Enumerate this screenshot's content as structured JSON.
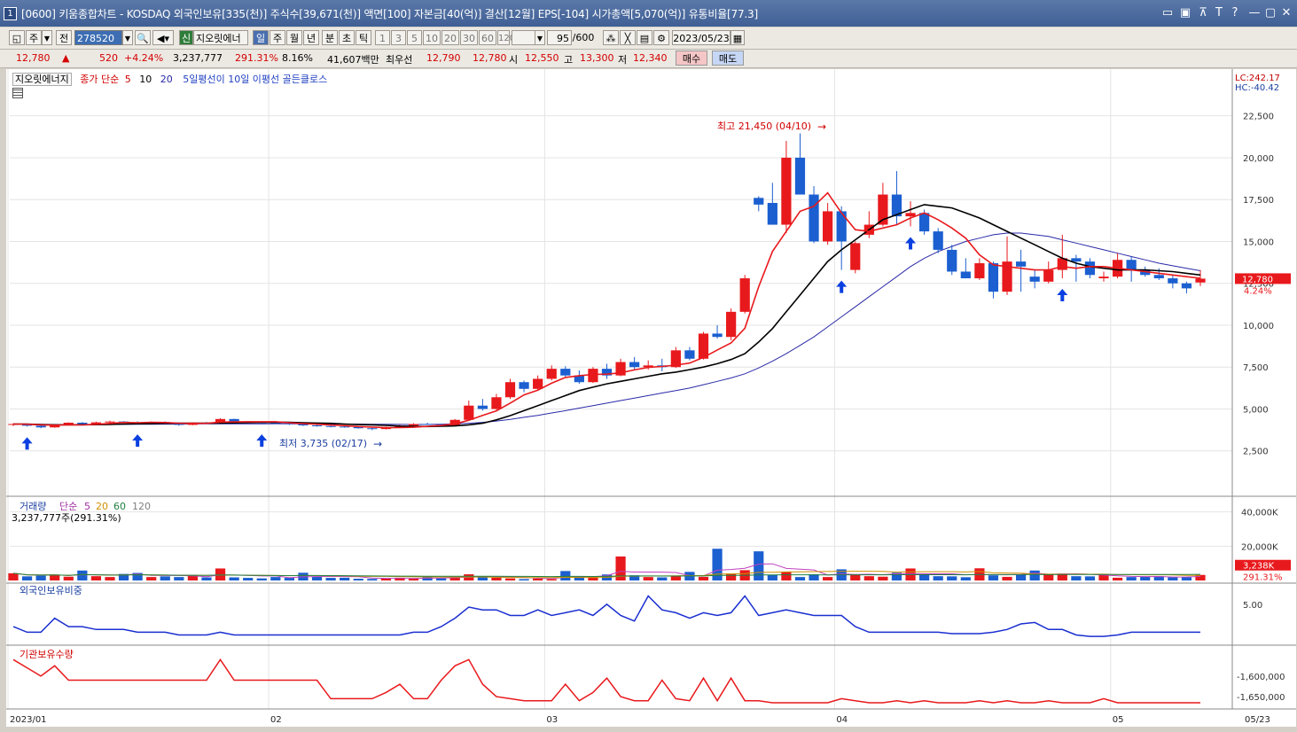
{
  "title": {
    "win_number": "1",
    "text": "[0600] 키움종합차트 - KOSDAQ 외국인보유[335(천)] 주식수[39,671(천)] 액면[100] 자본금[40(억)] 결산[12월] EPS[-104] 시가총액[5,070(억)] 유통비율[77.3]",
    "controls": [
      "▭",
      "▣",
      "⊼",
      "T",
      "?",
      "—",
      "▢",
      "✕"
    ]
  },
  "toolbar": {
    "period_label": "주",
    "prev_label": "전",
    "code": "278520",
    "name_tag": "신",
    "stock_name": "지오릿에너",
    "periods": [
      "일",
      "주",
      "월",
      "년",
      "분",
      "초",
      "틱"
    ],
    "active_period": "일",
    "intervals": [
      "1",
      "3",
      "5",
      "10",
      "20",
      "30",
      "60",
      "120"
    ],
    "count_value": "95",
    "count_total": "/600",
    "date": "2023/05/23"
  },
  "quote": {
    "price": "12,780",
    "arrow": "▲",
    "change": "520",
    "change_pct": "+4.24%",
    "volume": "3,237,777",
    "vol_ratio": "291.31%",
    "turnover": "8.16%",
    "amount": "41,607백만",
    "pref_label": "최우선",
    "ask": "12,790",
    "bid": "12,780",
    "open_label": "시",
    "open": "12,550",
    "high_label": "고",
    "high": "13,300",
    "low_label": "저",
    "low": "12,340",
    "buy_label": "매수",
    "sell_label": "매도"
  },
  "legend": {
    "stock_name": "지오릿에너지",
    "ma_label": "종가 단순",
    "ma_periods": [
      "5",
      "10",
      "20"
    ],
    "signal": "5일평선이 10일 이평선 골든클로스"
  },
  "price_panel": {
    "lc": "LC:242.17",
    "hc": "HC:-40.42",
    "yticks": [
      "22,500",
      "20,000",
      "17,500",
      "15,000",
      "12,500",
      "10,000",
      "7,500",
      "5,000",
      "2,500"
    ],
    "last_price": "12,780",
    "last_pct": "4.24%",
    "high_annotation": "최고 21,450 (04/10)",
    "low_annotation": "최저 3,735 (02/17)"
  },
  "volume_panel": {
    "label": "거래량",
    "ma_label": "단순",
    "ma_periods": [
      "5",
      "20",
      "60",
      "120"
    ],
    "current": "3,237,777주(291.31%)",
    "yticks": [
      "40,000K",
      "20,000K"
    ],
    "last_vol": "3,238K",
    "last_ratio": "291.31%"
  },
  "foreign_panel": {
    "label": "외국인보유비중",
    "ytick": "5.00"
  },
  "inst_panel": {
    "label": "기관보유수량",
    "yticks": [
      "-1,600,000",
      "-1,650,000"
    ]
  },
  "xaxis": {
    "labels": [
      "2023/01",
      "02",
      "03",
      "04",
      "05"
    ],
    "end_label": "05/23"
  },
  "colors": {
    "up": "#e8191c",
    "down": "#1b5fd0",
    "ma5": "#e8191c",
    "ma10": "#000000",
    "ma20": "#2a2aa8",
    "signal": "#0a3fe0"
  },
  "chart_data": {
    "type": "candlestick",
    "title": "지오릿에너지",
    "x": [
      "2023-01",
      "2023-02",
      "2023-03",
      "2023-04",
      "2023-05"
    ],
    "candles": [
      [
        4050,
        4150,
        3980,
        4100
      ],
      [
        4100,
        4120,
        3950,
        4000
      ],
      [
        4000,
        4020,
        3850,
        3900
      ],
      [
        3900,
        4080,
        3880,
        4050
      ],
      [
        4050,
        4200,
        4000,
        4180
      ],
      [
        4180,
        4220,
        4050,
        4100
      ],
      [
        4100,
        4250,
        4080,
        4200
      ],
      [
        4200,
        4300,
        4150,
        4250
      ],
      [
        4250,
        4270,
        4150,
        4200
      ],
      [
        4200,
        4260,
        4120,
        4150
      ],
      [
        4150,
        4250,
        4100,
        4220
      ],
      [
        4220,
        4260,
        4080,
        4120
      ],
      [
        4120,
        4150,
        4000,
        4050
      ],
      [
        4050,
        4200,
        4030,
        4180
      ],
      [
        4180,
        4220,
        4100,
        4150
      ],
      [
        4150,
        4450,
        4120,
        4400
      ],
      [
        4400,
        4420,
        4200,
        4250
      ],
      [
        4250,
        4280,
        4150,
        4200
      ],
      [
        4200,
        4230,
        4120,
        4180
      ],
      [
        4180,
        4210,
        4100,
        4150
      ],
      [
        4150,
        4180,
        4050,
        4100
      ],
      [
        4100,
        4120,
        3980,
        4020
      ],
      [
        4020,
        4050,
        3940,
        3980
      ],
      [
        3980,
        4010,
        3900,
        3950
      ],
      [
        3950,
        4000,
        3880,
        3920
      ],
      [
        3920,
        3960,
        3820,
        3850
      ],
      [
        3850,
        3900,
        3735,
        3800
      ],
      [
        3800,
        3950,
        3780,
        3900
      ],
      [
        3900,
        4050,
        3880,
        4000
      ],
      [
        4000,
        4150,
        3980,
        4100
      ],
      [
        4100,
        4180,
        4050,
        4080
      ],
      [
        4080,
        4120,
        3980,
        4000
      ],
      [
        4000,
        4400,
        3990,
        4350
      ],
      [
        4350,
        5500,
        4300,
        5200
      ],
      [
        5200,
        5600,
        4900,
        5000
      ],
      [
        5000,
        5900,
        4950,
        5700
      ],
      [
        5700,
        6800,
        5600,
        6600
      ],
      [
        6600,
        6700,
        6000,
        6200
      ],
      [
        6200,
        7000,
        6100,
        6800
      ],
      [
        6800,
        7600,
        6700,
        7400
      ],
      [
        7400,
        7550,
        6900,
        7000
      ],
      [
        7000,
        7300,
        6500,
        6600
      ],
      [
        6600,
        7500,
        6550,
        7400
      ],
      [
        7400,
        7700,
        6800,
        7000
      ],
      [
        7000,
        8000,
        6950,
        7800
      ],
      [
        7800,
        8100,
        7300,
        7500
      ],
      [
        7500,
        7900,
        7350,
        7600
      ],
      [
        7600,
        8000,
        7250,
        7500
      ],
      [
        7500,
        8700,
        7450,
        8500
      ],
      [
        8500,
        8700,
        7900,
        8000
      ],
      [
        8000,
        9600,
        7950,
        9500
      ],
      [
        9500,
        10000,
        9200,
        9300
      ],
      [
        9300,
        11000,
        9100,
        10800
      ],
      [
        10800,
        13000,
        10700,
        12800
      ],
      [
        17600,
        17700,
        16800,
        17200
      ],
      [
        17300,
        18500,
        16000,
        16000
      ],
      [
        16000,
        21000,
        15500,
        20000
      ],
      [
        20000,
        21450,
        19500,
        17800
      ],
      [
        17800,
        18300,
        14900,
        15000
      ],
      [
        15000,
        17300,
        14800,
        16800
      ],
      [
        16800,
        17100,
        13300,
        15000
      ],
      [
        13300,
        15000,
        13100,
        14900
      ],
      [
        15400,
        16800,
        15200,
        16000
      ],
      [
        16000,
        18500,
        15900,
        17800
      ],
      [
        17800,
        19200,
        16000,
        16500
      ],
      [
        16500,
        17400,
        15900,
        16700
      ],
      [
        16700,
        16900,
        15400,
        15600
      ],
      [
        15600,
        15800,
        14300,
        14500
      ],
      [
        14500,
        14800,
        13000,
        13200
      ],
      [
        13200,
        14000,
        12800,
        12800
      ],
      [
        12800,
        14000,
        12700,
        13700
      ],
      [
        13700,
        13800,
        11600,
        12000
      ],
      [
        12000,
        15300,
        11800,
        13800
      ],
      [
        13800,
        14500,
        12000,
        13500
      ],
      [
        12900,
        13300,
        12200,
        12600
      ],
      [
        12600,
        13800,
        12500,
        13300
      ],
      [
        13300,
        15400,
        12800,
        14000
      ],
      [
        14000,
        14200,
        12600,
        13800
      ],
      [
        13800,
        14000,
        12800,
        13000
      ],
      [
        12800,
        13200,
        12600,
        12900
      ],
      [
        12900,
        14300,
        12800,
        13900
      ],
      [
        13900,
        14100,
        12600,
        13300
      ],
      [
        13300,
        13500,
        12900,
        13000
      ],
      [
        13000,
        13400,
        12700,
        12800
      ],
      [
        12800,
        13000,
        12200,
        12500
      ],
      [
        12500,
        12600,
        11900,
        12200
      ],
      [
        12550,
        13300,
        12340,
        12780
      ]
    ],
    "ma5": [
      4100,
      4090,
      4050,
      4030,
      4056,
      4046,
      4082,
      4136,
      4196,
      4180,
      4205,
      4188,
      4148,
      4144,
      4144,
      4216,
      4228,
      4236,
      4238,
      4236,
      4176,
      4126,
      4090,
      4044,
      4004,
      3954,
      3922,
      3882,
      3888,
      3912,
      3962,
      4016,
      4106,
      4330,
      4618,
      4890,
      5350,
      5840,
      6120,
      6540,
      6880,
      6990,
      7060,
      7080,
      7160,
      7330,
      7480,
      7540,
      7620,
      7740,
      8080,
      8520,
      8940,
      9820,
      12300,
      14400,
      15600,
      16800,
      17100,
      17900,
      16700,
      15700,
      15600,
      15800,
      16000,
      16400,
      16700,
      16300,
      15800,
      15200,
      14200,
      13600,
      13500,
      13400,
      13300,
      13300,
      13500,
      13400,
      13500,
      13500,
      13400,
      13300,
      13200,
      13100,
      13000,
      12900,
      12800
    ],
    "ma10": [
      4100,
      4095,
      4066,
      4050,
      4060,
      4055,
      4065,
      4080,
      4100,
      4115,
      4130,
      4140,
      4148,
      4150,
      4150,
      4160,
      4170,
      4180,
      4200,
      4210,
      4200,
      4180,
      4160,
      4140,
      4100,
      4070,
      4050,
      4020,
      3980,
      3960,
      3950,
      3970,
      3990,
      4050,
      4150,
      4350,
      4600,
      4900,
      5200,
      5500,
      5800,
      6100,
      6300,
      6500,
      6650,
      6800,
      6950,
      7100,
      7200,
      7350,
      7500,
      7700,
      7950,
      8300,
      9000,
      9800,
      10800,
      11800,
      12800,
      13800,
      14500,
      15100,
      15700,
      16300,
      16600,
      16900,
      17200,
      17100,
      17000,
      16700,
      16400,
      16000,
      15600,
      15200,
      14800,
      14400,
      14000,
      13700,
      13500,
      13400,
      13300,
      13300,
      13300,
      13250,
      13200,
      13100,
      13000
    ],
    "ma20": [
      4100,
      4095,
      4080,
      4075,
      4070,
      4070,
      4072,
      4075,
      4080,
      4085,
      4090,
      4095,
      4100,
      4105,
      4108,
      4110,
      4112,
      4115,
      4118,
      4120,
      4118,
      4115,
      4110,
      4105,
      4100,
      4095,
      4090,
      4085,
      4080,
      4075,
      4080,
      4090,
      4110,
      4150,
      4200,
      4280,
      4380,
      4500,
      4620,
      4760,
      4900,
      5050,
      5200,
      5350,
      5500,
      5650,
      5800,
      5950,
      6100,
      6250,
      6450,
      6650,
      6850,
      7100,
      7450,
      7850,
      8300,
      8800,
      9300,
      9900,
      10500,
      11100,
      11700,
      12300,
      12900,
      13500,
      14000,
      14400,
      14700,
      15000,
      15200,
      15400,
      15500,
      15500,
      15400,
      15300,
      15100,
      14900,
      14700,
      14500,
      14300,
      14100,
      13900,
      13700,
      13550,
      13400,
      13250
    ],
    "volume": [
      4200,
      2400,
      2800,
      3400,
      2200,
      5800,
      2500,
      2000,
      3800,
      4400,
      2000,
      2400,
      2000,
      3000,
      1800,
      7000,
      1800,
      1500,
      1200,
      2000,
      1500,
      4500,
      2200,
      1500,
      1600,
      1000,
      900,
      1200,
      1600,
      1300,
      1800,
      1200,
      2000,
      3600,
      1800,
      1600,
      1200,
      800,
      1100,
      800,
      5500,
      2000,
      2000,
      3500,
      14000,
      3000,
      2000,
      1800,
      2500,
      5000,
      2100,
      18500,
      4000,
      6000,
      17000,
      3200,
      5000,
      2000,
      3600,
      2000,
      6500,
      3600,
      2500,
      2200,
      4500,
      7000,
      3100,
      2500,
      2400,
      1900,
      7100,
      3000,
      2100,
      3600,
      5800,
      3500,
      4000,
      2500,
      2400,
      3300,
      1600,
      2000,
      2200,
      2500,
      1800,
      1900,
      3238
    ],
    "foreign_ratio": [
      4.2,
      4.0,
      4.0,
      4.5,
      4.2,
      4.2,
      4.1,
      4.1,
      4.1,
      4.0,
      4.0,
      4.0,
      3.9,
      3.9,
      3.9,
      4.0,
      3.9,
      3.9,
      3.9,
      3.9,
      3.9,
      3.9,
      3.9,
      3.9,
      3.9,
      3.9,
      3.9,
      3.9,
      3.9,
      4.0,
      4.0,
      4.2,
      4.5,
      4.9,
      4.8,
      4.8,
      4.6,
      4.6,
      4.8,
      4.6,
      4.7,
      4.8,
      4.6,
      5.0,
      4.6,
      4.4,
      5.3,
      4.8,
      4.7,
      4.5,
      4.7,
      4.6,
      4.7,
      5.3,
      4.6,
      4.7,
      4.8,
      4.7,
      4.6,
      4.6,
      4.6,
      4.2,
      4.0,
      4.0,
      4.0,
      4.0,
      4.0,
      4.0,
      3.95,
      3.95,
      3.95,
      4.0,
      4.1,
      4.3,
      4.35,
      4.1,
      4.1,
      3.9,
      3.85,
      3.85,
      3.9,
      4.0,
      4.0,
      4.0,
      4.0,
      4.0,
      4.0
    ],
    "inst_holding": [
      -1560000,
      -1580000,
      -1600000,
      -1575000,
      -1610000,
      -1610000,
      -1610000,
      -1610000,
      -1610000,
      -1610000,
      -1610000,
      -1610000,
      -1610000,
      -1610000,
      -1610000,
      -1560000,
      -1610000,
      -1610000,
      -1610000,
      -1610000,
      -1610000,
      -1610000,
      -1610000,
      -1655000,
      -1655000,
      -1655000,
      -1655000,
      -1640000,
      -1620000,
      -1655000,
      -1655000,
      -1610000,
      -1575000,
      -1560000,
      -1620000,
      -1650000,
      -1655000,
      -1660000,
      -1660000,
      -1660000,
      -1620000,
      -1660000,
      -1640000,
      -1605000,
      -1650000,
      -1660000,
      -1660000,
      -1610000,
      -1655000,
      -1660000,
      -1605000,
      -1660000,
      -1605000,
      -1660000,
      -1660000,
      -1665000,
      -1665000,
      -1665000,
      -1665000,
      -1665000,
      -1655000,
      -1660000,
      -1665000,
      -1665000,
      -1660000,
      -1665000,
      -1660000,
      -1665000,
      -1665000,
      -1665000,
      -1660000,
      -1665000,
      -1660000,
      -1665000,
      -1665000,
      -1660000,
      -1665000,
      -1665000,
      -1665000,
      -1655000,
      -1665000,
      -1665000,
      -1665000,
      -1665000,
      -1665000,
      -1665000,
      -1665000
    ],
    "golden_cross_signals": [
      1,
      9,
      18,
      60,
      65,
      76
    ],
    "ylim_price": [
      0,
      23700
    ],
    "ylim_volume": [
      0,
      45000
    ],
    "ylim_foreign": [
      3.6,
      5.6
    ],
    "ylim_inst": [
      -1680000,
      -1540000
    ]
  }
}
